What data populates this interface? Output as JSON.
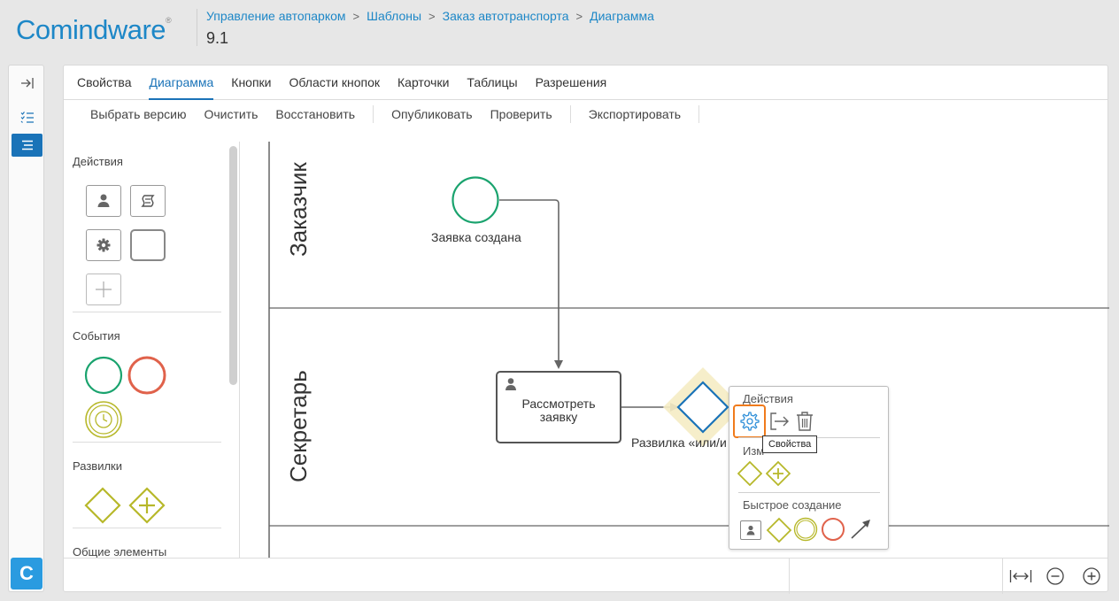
{
  "app": {
    "logo_text": "Comindware",
    "logo_mark": "®",
    "page_title": "9.1"
  },
  "breadcrumb": [
    "Управление автопарком",
    "Шаблоны",
    "Заказ автотранспорта",
    "Диаграмма"
  ],
  "rail": {
    "logo_letter": "C"
  },
  "tabs": [
    "Свойства",
    "Диаграмма",
    "Кнопки",
    "Области кнопок",
    "Карточки",
    "Таблицы",
    "Разрешения"
  ],
  "toolbar": {
    "select_version": "Выбрать версию",
    "clear": "Очистить",
    "restore": "Восстановить",
    "publish": "Опубликовать",
    "validate": "Проверить",
    "export": "Экспортировать"
  },
  "palette": {
    "actions": "Действия",
    "events": "События",
    "gateways": "Развилки",
    "common": "Общие элементы"
  },
  "diagram": {
    "lanes": [
      "Заказчик",
      "Секретарь"
    ],
    "start_event_label": "Заявка создана",
    "task_label_line1": "Рассмотреть",
    "task_label_line2": "заявку",
    "gateway_label": "Развилка «или/и"
  },
  "context_menu": {
    "actions": "Действия",
    "change": "Изм",
    "quick_create": "Быстрое создание",
    "tooltip": "Свойства"
  },
  "colors": {
    "accent": "#1a73b8",
    "start_event": "#1aa36e",
    "end_event": "#e0624b",
    "gateway": "#b7b82a",
    "highlight": "#f07b1c"
  }
}
